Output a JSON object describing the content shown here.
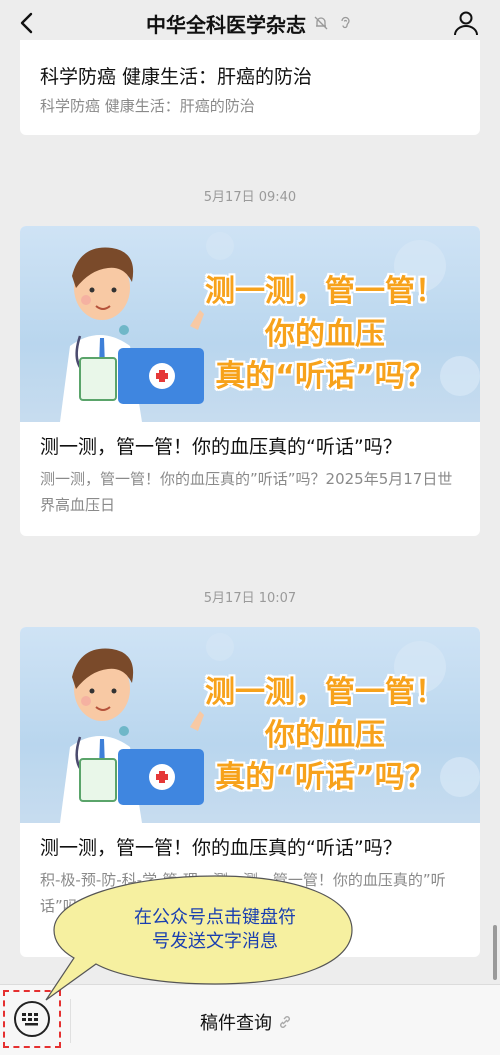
{
  "header": {
    "title": "中华全科医学杂志"
  },
  "top_card": {
    "title": "科学防癌 健康生活：肝癌的防治",
    "subtitle": "科学防癌 健康生活：肝癌的防治"
  },
  "messages": [
    {
      "timestamp": "5月17日 09:40",
      "image_lines": [
        "测一测，管一管！",
        "你的血压",
        "真的“听话”吗？"
      ],
      "title": "测一测，管一管！你的血压真的“听话”吗？",
      "description": "测一测，管一管！你的血压真的”听话”吗？2025年5月17日世界高血压日"
    },
    {
      "timestamp": "5月17日 10:07",
      "image_lines": [
        "测一测，管一管！",
        "你的血压",
        "真的“听话”吗？"
      ],
      "title": "测一测，管一管！你的血压真的“听话”吗？",
      "description": "积-极-预-防-科-学-管-理，测一测，管一管！你的血压真的”听话”吗？2025年5月17日世界高血压日"
    }
  ],
  "bottom_bar": {
    "menu_label": "稿件查询"
  },
  "tooltip": {
    "line1": "在公众号点击键盘符",
    "line2": "号发送文字消息"
  },
  "colors": {
    "background": "#ededed",
    "card": "#ffffff",
    "headline_orange": "#f7a21b",
    "tooltip_fill": "#f6f0a0",
    "tooltip_text": "#1a3fb0",
    "highlight_dash": "#e53030"
  },
  "icons": {
    "back": "chevron-left-icon",
    "mute": "bell-muted-icon",
    "ear": "ear-icon",
    "profile": "person-icon",
    "keyboard": "keyboard-icon",
    "link": "link-icon"
  }
}
